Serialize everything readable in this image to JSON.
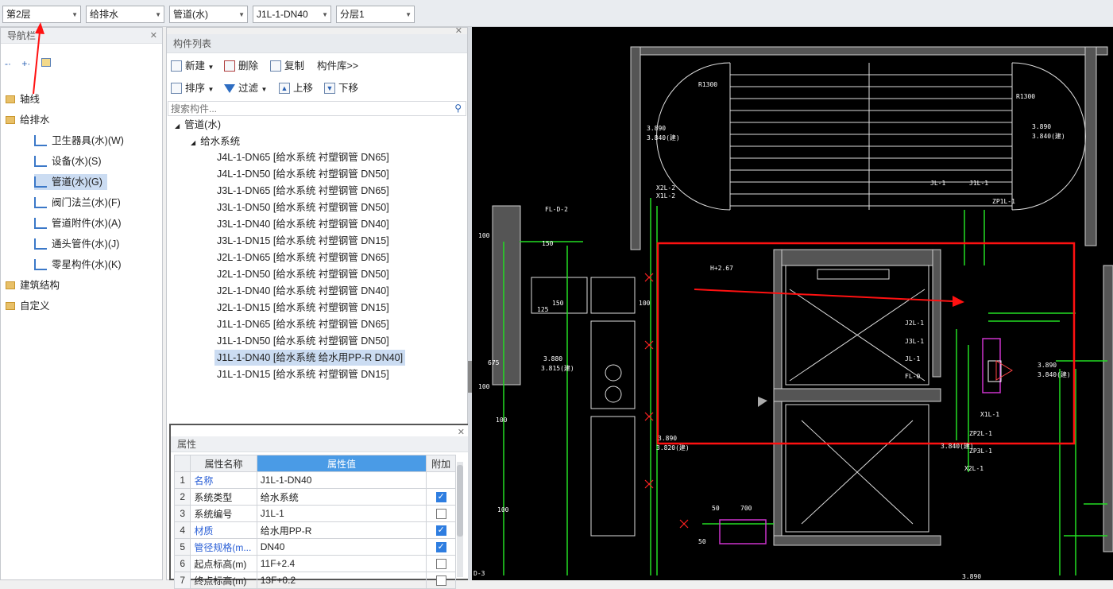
{
  "toolbar": {
    "floor": "第2层",
    "discipline": "给排水",
    "category": "管道(水)",
    "component": "J1L-1-DN40",
    "sublayer": "分层1"
  },
  "nav": {
    "title": "导航栏",
    "tree": [
      {
        "label": "轴线",
        "type": "folder"
      },
      {
        "label": "给排水",
        "type": "folder-open"
      },
      {
        "label": "卫生器具(水)(W)",
        "type": "child"
      },
      {
        "label": "设备(水)(S)",
        "type": "child"
      },
      {
        "label": "管道(水)(G)",
        "type": "child",
        "selected": true
      },
      {
        "label": "阀门法兰(水)(F)",
        "type": "child"
      },
      {
        "label": "管道附件(水)(A)",
        "type": "child"
      },
      {
        "label": "通头管件(水)(J)",
        "type": "child"
      },
      {
        "label": "零星构件(水)(K)",
        "type": "child"
      },
      {
        "label": "建筑结构",
        "type": "folder"
      },
      {
        "label": "自定义",
        "type": "folder"
      }
    ]
  },
  "list": {
    "title": "构件列表",
    "new_label": "新建",
    "delete_label": "删除",
    "copy_label": "复制",
    "library_label": "构件库>>",
    "sort_label": "排序",
    "filter_label": "过滤",
    "up_label": "上移",
    "down_label": "下移",
    "search_placeholder": "搜索构件...",
    "group": "管道(水)",
    "subgroup": "给水系统",
    "items": [
      "J4L-1-DN65 [给水系统 衬塑钢管 DN65]",
      "J4L-1-DN50 [给水系统 衬塑钢管 DN50]",
      "J3L-1-DN65 [给水系统 衬塑钢管 DN65]",
      "J3L-1-DN50 [给水系统 衬塑钢管 DN50]",
      "J3L-1-DN40 [给水系统 衬塑钢管 DN40]",
      "J3L-1-DN15 [给水系统 衬塑钢管 DN15]",
      "J2L-1-DN65 [给水系统 衬塑钢管 DN65]",
      "J2L-1-DN50 [给水系统 衬塑钢管 DN50]",
      "J2L-1-DN40 [给水系统 衬塑钢管 DN40]",
      "J2L-1-DN15 [给水系统 衬塑钢管 DN15]",
      "J1L-1-DN65 [给水系统 衬塑钢管 DN65]",
      "J1L-1-DN50 [给水系统 衬塑钢管 DN50]",
      "J1L-1-DN40 [给水系统 给水用PP-R DN40]",
      "J1L-1-DN15 [给水系统 衬塑钢管 DN15]"
    ],
    "selected_index": 12
  },
  "props": {
    "title": "属性",
    "col_name": "属性名称",
    "col_value": "属性值",
    "col_extra": "附加",
    "rows": [
      {
        "n": "1",
        "name": "名称",
        "value": "J1L-1-DN40",
        "blue": true,
        "check": null
      },
      {
        "n": "2",
        "name": "系统类型",
        "value": "给水系统",
        "blue": false,
        "check": true
      },
      {
        "n": "3",
        "name": "系统编号",
        "value": "J1L-1",
        "blue": false,
        "check": false
      },
      {
        "n": "4",
        "name": "材质",
        "value": "给水用PP-R",
        "blue": true,
        "check": true
      },
      {
        "n": "5",
        "name": "管径规格(m...",
        "value": "DN40",
        "blue": true,
        "check": true
      },
      {
        "n": "6",
        "name": "起点标高(m)",
        "value": "11F+2.4",
        "blue": false,
        "check": false
      },
      {
        "n": "7",
        "name": "终点标高(m)",
        "value": "13F+0.2",
        "blue": false,
        "check": false
      }
    ]
  },
  "cad": {
    "labels": [
      "R1300",
      "R1300",
      "3.890",
      "3.840(建)",
      "3.890",
      "3.840(建)",
      "X2L-2",
      "X1L-2",
      "FL-D-2",
      "JL-1",
      "J1L-1",
      "ZP1L-1",
      "J2L-1",
      "J3L-1",
      "JL-1",
      "FL-0",
      "X1L-1",
      "ZP2L-1",
      "ZP3L-1",
      "X2L-1",
      "H+2.67",
      "3.880",
      "3.815(建)",
      "3.890",
      "3.840(建)",
      "3.840(建)",
      "3.890",
      "3.820(建)",
      "3.890",
      "150",
      "150",
      "125",
      "675",
      "100",
      "100",
      "100",
      "100",
      "100",
      "700",
      "50",
      "50",
      "D-3"
    ]
  },
  "colors": {
    "accent": "#4a9be6",
    "selection": "#cbdcf2",
    "annotation_red": "#ff0000",
    "cad_bg": "#000000",
    "cad_pipe": "#22dd22"
  }
}
